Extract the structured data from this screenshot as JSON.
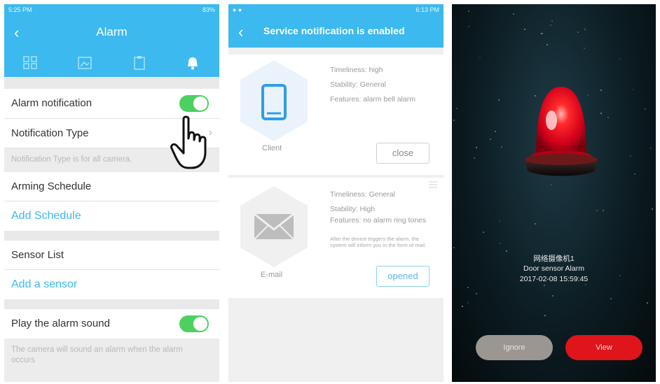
{
  "screen1": {
    "status_time": "5:25 PM",
    "status_right": "83%",
    "title": "Alarm",
    "rows": {
      "alarm_notification": "Alarm notification",
      "notification_type": "Notification Type",
      "notification_hint": "Notification Type is for all camera.",
      "arming_schedule": "Arming Schedule",
      "add_schedule": "Add Schedule",
      "sensor_list": "Sensor List",
      "add_sensor": "Add a sensor",
      "play_alarm_sound": "Play the alarm sound",
      "sound_hint": "The camera will sound an alarm when the alarm occurs"
    },
    "toggles": {
      "alarm_notification_on": true,
      "play_alarm_sound_on": true
    },
    "colors": {
      "accent": "#3cb9ee",
      "toggle_on": "#4cd160"
    }
  },
  "screen2": {
    "status_time": "6:13 PM",
    "title": "Service notification is enabled",
    "client": {
      "timeliness": "Timeliness: high",
      "stability": "Stability: General",
      "features": "Features: alarm bell alarm",
      "name": "Client",
      "button": "close"
    },
    "email": {
      "timeliness": "Timeliness: General",
      "stability": "Stability: High",
      "features": "Features: no alarm ring tones",
      "note": "After the device triggers the alarm, the system will inform you in the form of mail.",
      "name": "E-mail",
      "button": "opened"
    }
  },
  "screen3": {
    "device_name": "网络摄像机1",
    "alarm_type": "Door sensor Alarm",
    "timestamp": "2017-02-08 15:59:45",
    "ignore_label": "Ignore",
    "view_label": "View",
    "colors": {
      "ignore": "#9b9692",
      "view": "#e0141b"
    }
  }
}
